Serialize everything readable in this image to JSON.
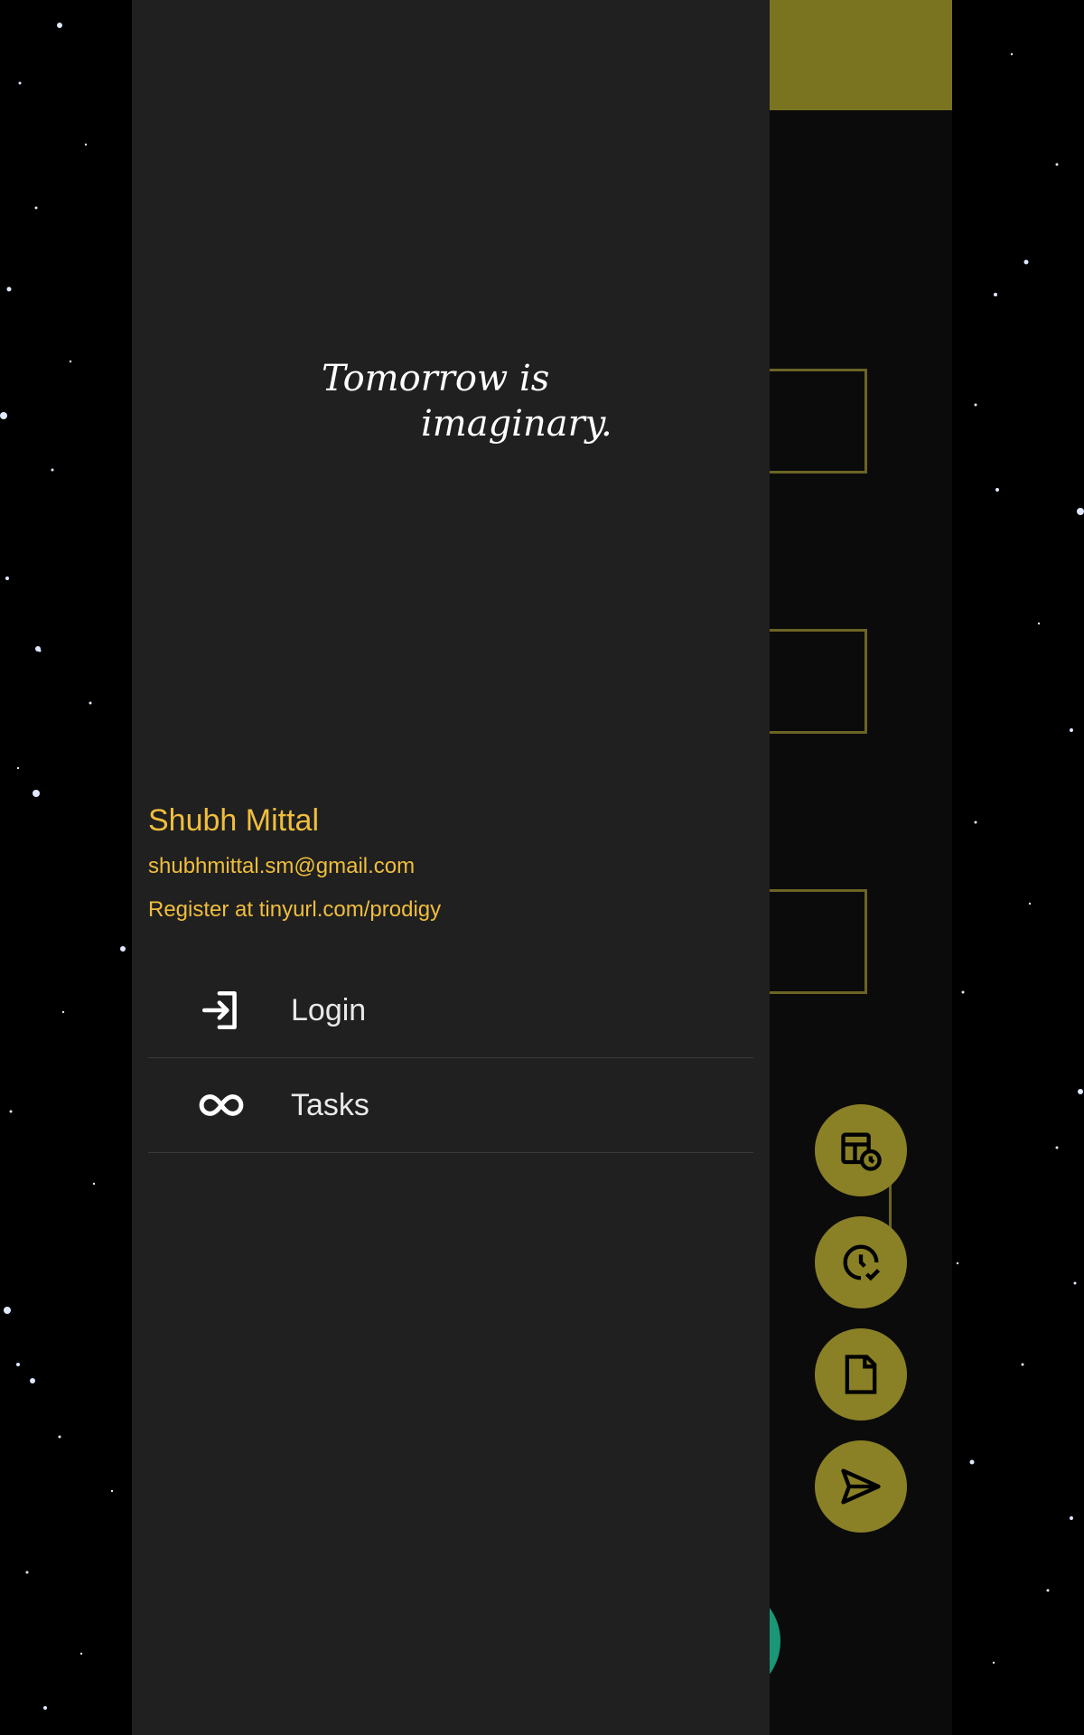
{
  "drawer": {
    "quote_line1": "Tomorrow is",
    "quote_line2": "imaginary.",
    "user_name": "Shubh Mittal",
    "user_email": "shubhmittal.sm@gmail.com",
    "register_text": "Register at tinyurl.com/prodigy",
    "menu": [
      {
        "label": "Login",
        "icon": "login-icon"
      },
      {
        "label": "Tasks",
        "icon": "infinity-icon"
      }
    ]
  },
  "fabs": [
    {
      "icon": "table-schedule-icon"
    },
    {
      "icon": "clock-check-icon"
    },
    {
      "icon": "note-icon"
    },
    {
      "icon": "send-icon"
    },
    {
      "icon": "plus-icon"
    }
  ],
  "colors": {
    "accent": "#f0be3c",
    "drawer_bg": "#202020",
    "appbar": "#7a7320",
    "fab": "#8a8126",
    "fab_main": "#1a9776"
  }
}
